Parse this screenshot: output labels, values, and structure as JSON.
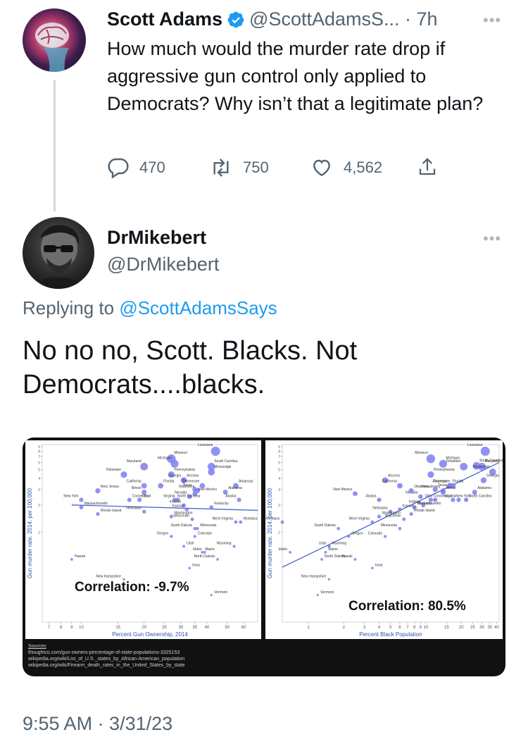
{
  "tweet1": {
    "name": "Scott Adams",
    "handle_time": "@ScottAdamsS... · 7h",
    "text": "How much would the murder rate drop if aggressive gun control only applied to Democrats? Why isn’t that a legitimate plan?",
    "replies": "470",
    "retweets": "750",
    "likes": "4,562"
  },
  "tweet2": {
    "name": "DrMikebert",
    "handle": "@DrMikebert",
    "replying_prefix": "Replying to ",
    "replying_handle": "@ScottAdamsSays",
    "text": "No no no, Scott. Blacks. Not Democrats....blacks.",
    "timestamp": "9:55 AM · 3/31/23"
  },
  "image": {
    "sources_title": "Sources",
    "sources": [
      "thoughtco.com/gun-owners-percentage-of-state-populations-3325153",
      "wikipedia.org/wiki/List_of_U.S._states_by_African-American_population",
      "wikipedia.org/wiki/Firearm_death_rates_in_the_United_States_by_state"
    ]
  },
  "chart_data": [
    {
      "type": "scatter",
      "title": "",
      "annotation": "Correlation: -9.7%",
      "xlabel": "Percent Gun Ownership, 2014",
      "ylabel": "Gun murder rate, 2014, per 100,000",
      "x_scale": "log",
      "y_scale": "log",
      "x_ticks": [
        "7",
        "8",
        "9",
        "10",
        "15",
        "20",
        "25",
        "30",
        "35",
        "40",
        "50",
        "60"
      ],
      "y_ticks": [
        "9",
        "8",
        "7",
        "6",
        "5",
        "4",
        "3",
        "2",
        "1"
      ],
      "xlim": [
        6.5,
        70
      ],
      "ylim": [
        0.1,
        9.5
      ],
      "points": [
        {
          "label": "Louisiana",
          "x": 44,
          "y": 8.0
        },
        {
          "label": "Missouri",
          "x": 27,
          "y": 6.6
        },
        {
          "label": "Michigan",
          "x": 28,
          "y": 5.8
        },
        {
          "label": "South Carolina",
          "x": 42,
          "y": 5.4
        },
        {
          "label": "Maryland",
          "x": 20,
          "y": 5.4
        },
        {
          "label": "Mississippi",
          "x": 42,
          "y": 4.7
        },
        {
          "label": "Delaware",
          "x": 16,
          "y": 4.4
        },
        {
          "label": "Pennsylvania",
          "x": 27,
          "y": 4.4
        },
        {
          "label": "Georgia",
          "x": 31,
          "y": 3.8
        },
        {
          "label": "Arizona",
          "x": 31,
          "y": 3.8
        },
        {
          "label": "California",
          "x": 20,
          "y": 3.3
        },
        {
          "label": "Florida",
          "x": 24,
          "y": 3.3
        },
        {
          "label": "Tennessee",
          "x": 38,
          "y": 3.3
        },
        {
          "label": "Arkansas",
          "x": 55,
          "y": 3.3
        },
        {
          "label": "Texas",
          "x": 35,
          "y": 3.0
        },
        {
          "label": "Alabama",
          "x": 49,
          "y": 2.8
        },
        {
          "label": "Oklahoma",
          "x": 36,
          "y": 2.9
        },
        {
          "label": "New Jersey",
          "x": 12,
          "y": 2.9
        },
        {
          "label": "Illinois",
          "x": 20,
          "y": 2.8
        },
        {
          "label": "New Mexico",
          "x": 35,
          "y": 2.7
        },
        {
          "label": "Nevada",
          "x": 33,
          "y": 2.5
        },
        {
          "label": "Connecticut",
          "x": 17,
          "y": 2.3
        },
        {
          "label": "New York",
          "x": 10,
          "y": 2.3
        },
        {
          "label": "Ohio",
          "x": 19,
          "y": 2.3
        },
        {
          "label": "Virginia",
          "x": 29,
          "y": 2.3
        },
        {
          "label": "North Carolina",
          "x": 28,
          "y": 2.3
        },
        {
          "label": "Alaska",
          "x": 57,
          "y": 2.3
        },
        {
          "label": "Massachusetts",
          "x": 10,
          "y": 1.9
        },
        {
          "label": "Indiana",
          "x": 31,
          "y": 2.0
        },
        {
          "label": "Kentucky",
          "x": 42,
          "y": 1.9
        },
        {
          "label": "Kansas",
          "x": 32,
          "y": 1.8
        },
        {
          "label": "Rhode Island",
          "x": 12,
          "y": 1.6
        },
        {
          "label": "Nebraska",
          "x": 20,
          "y": 1.7
        },
        {
          "label": "Washington",
          "x": 27,
          "y": 1.5
        },
        {
          "label": "Wisconsin",
          "x": 34,
          "y": 1.4
        },
        {
          "label": "Montana",
          "x": 58,
          "y": 1.3
        },
        {
          "label": "West Virginia",
          "x": 55,
          "y": 1.3
        },
        {
          "label": "Minnesota",
          "x": 36,
          "y": 1.1
        },
        {
          "label": "South Dakota",
          "x": 35,
          "y": 1.1
        },
        {
          "label": "Colorado",
          "x": 35,
          "y": 0.9
        },
        {
          "label": "Oregon",
          "x": 27,
          "y": 0.9
        },
        {
          "label": "Utah",
          "x": 31,
          "y": 0.7
        },
        {
          "label": "Wyoming",
          "x": 54,
          "y": 0.7
        },
        {
          "label": "Maine",
          "x": 38,
          "y": 0.6
        },
        {
          "label": "Idaho",
          "x": 39,
          "y": 0.6
        },
        {
          "label": "Iowa",
          "x": 33,
          "y": 0.4
        },
        {
          "label": "North Dakota",
          "x": 45,
          "y": 0.5
        },
        {
          "label": "Hawaii",
          "x": 9,
          "y": 0.5
        },
        {
          "label": "New Hampshire",
          "x": 16,
          "y": 0.3
        },
        {
          "label": "Vermont",
          "x": 42,
          "y": 0.2
        }
      ],
      "trend_line": true,
      "grid": false,
      "legend": "none"
    },
    {
      "type": "scatter",
      "title": "",
      "annotation": "Correlation: 80.5%",
      "xlabel": "Percent Black Population",
      "ylabel": "Gun murder rate, 2014, per 100,000",
      "x_scale": "log",
      "y_scale": "log",
      "x_ticks": [
        "1",
        "2",
        "3",
        "4",
        "5",
        "6",
        "7",
        "8",
        "9",
        "10",
        "15",
        "20",
        "25",
        "30",
        "35",
        "40"
      ],
      "y_ticks": [
        "9",
        "8",
        "7",
        "6",
        "5",
        "4",
        "3",
        "2",
        "1"
      ],
      "xlim": [
        0.6,
        42
      ],
      "ylim": [
        0.1,
        9.5
      ],
      "points": [
        {
          "label": "Missouri",
          "x": 11,
          "y": 6.6
        },
        {
          "label": "South Carolina",
          "x": 27,
          "y": 5.5
        },
        {
          "label": "Louisiana",
          "x": 32,
          "y": 8.0
        },
        {
          "label": "Pennsylvania",
          "x": 11,
          "y": 4.4
        },
        {
          "label": "Delaware",
          "x": 21,
          "y": 5.4
        },
        {
          "label": "Maryland",
          "x": 30,
          "y": 5.4
        },
        {
          "label": "Nevada",
          "x": 9,
          "y": 2.5
        },
        {
          "label": "Michigan",
          "x": 14,
          "y": 5.8
        },
        {
          "label": "Mississippi",
          "x": 37,
          "y": 4.7
        },
        {
          "label": "Arizona",
          "x": 4.5,
          "y": 3.8
        },
        {
          "label": "California",
          "x": 6.0,
          "y": 3.3
        },
        {
          "label": "Florida",
          "x": 16,
          "y": 3.3
        },
        {
          "label": "Tennessee",
          "x": 17,
          "y": 3.3
        },
        {
          "label": "Texas",
          "x": 12,
          "y": 3.0
        },
        {
          "label": "Virginia",
          "x": 19,
          "y": 2.3
        },
        {
          "label": "Georgia",
          "x": 31,
          "y": 3.8
        },
        {
          "label": "New Mexico",
          "x": 2.5,
          "y": 2.7
        },
        {
          "label": "Oklahoma",
          "x": 7.5,
          "y": 2.9
        },
        {
          "label": "New Jersey",
          "x": 14,
          "y": 2.9
        },
        {
          "label": "Connecticut",
          "x": 11,
          "y": 2.3
        },
        {
          "label": "Arkansas",
          "x": 16,
          "y": 3.3
        },
        {
          "label": "Alabama",
          "x": 26,
          "y": 2.8
        },
        {
          "label": "Alaska",
          "x": 4.0,
          "y": 2.3
        },
        {
          "label": "Kentucky",
          "x": 8.0,
          "y": 1.9
        },
        {
          "label": "Ohio",
          "x": 12,
          "y": 2.3
        },
        {
          "label": "North Carolina",
          "x": 22,
          "y": 2.3
        },
        {
          "label": "Nebraska",
          "x": 5.0,
          "y": 1.7
        },
        {
          "label": "Kansas",
          "x": 6.0,
          "y": 1.8
        },
        {
          "label": "Indiana",
          "x": 9.5,
          "y": 2.0
        },
        {
          "label": "Illinois",
          "x": 14,
          "y": 2.8
        },
        {
          "label": "West Virginia",
          "x": 3.5,
          "y": 1.3
        },
        {
          "label": "New York",
          "x": 17,
          "y": 2.3
        },
        {
          "label": "Wisconsin",
          "x": 6.5,
          "y": 1.4
        },
        {
          "label": "Massachusetts",
          "x": 8.0,
          "y": 1.9
        },
        {
          "label": "Montana",
          "x": 0.6,
          "y": 1.3
        },
        {
          "label": "Rhode Island",
          "x": 7.5,
          "y": 1.6
        },
        {
          "label": "South Dakota",
          "x": 1.8,
          "y": 1.1
        },
        {
          "label": "Washington",
          "x": 4.0,
          "y": 1.5
        },
        {
          "label": "Colorado",
          "x": 4.5,
          "y": 0.9
        },
        {
          "label": "Wyoming",
          "x": 1.5,
          "y": 0.7
        },
        {
          "label": "Idaho",
          "x": 0.7,
          "y": 0.6
        },
        {
          "label": "Oregon",
          "x": 2.2,
          "y": 0.9
        },
        {
          "label": "Minnesota",
          "x": 6.0,
          "y": 1.1
        },
        {
          "label": "Maine",
          "x": 1.4,
          "y": 0.6
        },
        {
          "label": "Utah",
          "x": 1.5,
          "y": 0.7
        },
        {
          "label": "Iowa",
          "x": 3.5,
          "y": 0.4
        },
        {
          "label": "Hawaii",
          "x": 2.5,
          "y": 0.5
        },
        {
          "label": "North Dakota",
          "x": 1.3,
          "y": 0.5
        },
        {
          "label": "New Hampshire",
          "x": 1.5,
          "y": 0.3
        },
        {
          "label": "Vermont",
          "x": 1.2,
          "y": 0.2
        }
      ],
      "trend_line": true,
      "grid": false,
      "legend": "none"
    }
  ],
  "colors": {
    "link": "#1d9bf0",
    "verified": "#1d9bf0",
    "muted": "#536471",
    "point_fill": "#7b7ff0",
    "trend_line": "#3b5bc7",
    "image_bg": "#111111"
  },
  "icons": {
    "reply": "reply-icon",
    "retweet": "retweet-icon",
    "like": "heart-icon",
    "share": "share-icon",
    "verified": "verified-badge-icon",
    "more": "more-icon"
  }
}
